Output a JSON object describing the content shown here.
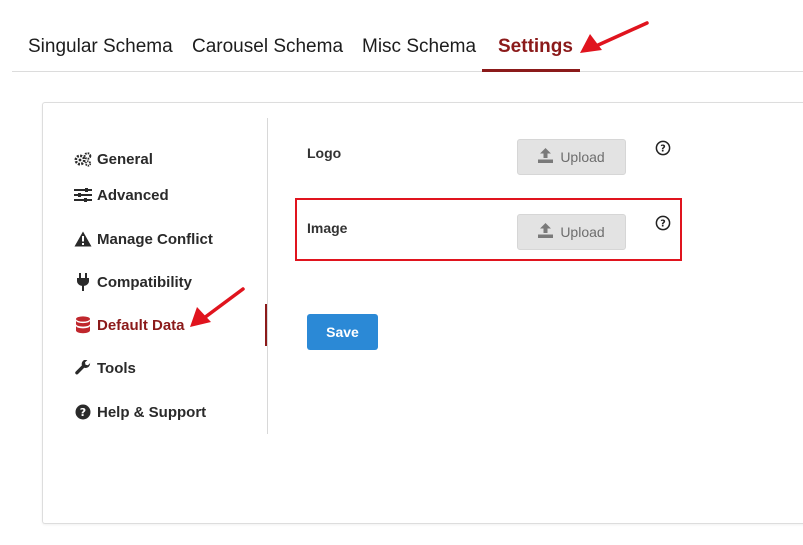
{
  "tabs": [
    {
      "label": "Singular Schema"
    },
    {
      "label": "Carousel Schema"
    },
    {
      "label": "Misc Schema"
    },
    {
      "label": "Settings",
      "active": true
    }
  ],
  "sidebar": {
    "items": [
      {
        "label": "General",
        "icon": "cogs-icon"
      },
      {
        "label": "Advanced",
        "icon": "sliders-icon"
      },
      {
        "label": "Manage Conflict",
        "icon": "warning-icon"
      },
      {
        "label": "Compatibility",
        "icon": "plug-icon"
      },
      {
        "label": "Default Data",
        "icon": "database-icon",
        "active": true
      },
      {
        "label": "Tools",
        "icon": "wrench-icon"
      },
      {
        "label": "Help & Support",
        "icon": "question-circle-icon"
      }
    ]
  },
  "fields": {
    "logo": {
      "label": "Logo",
      "button": "Upload"
    },
    "image": {
      "label": "Image",
      "button": "Upload"
    }
  },
  "actions": {
    "save_label": "Save"
  },
  "colors": {
    "accent": "#8b1a1a",
    "primary_button": "#2b89d6",
    "annotation": "#e0141e"
  }
}
